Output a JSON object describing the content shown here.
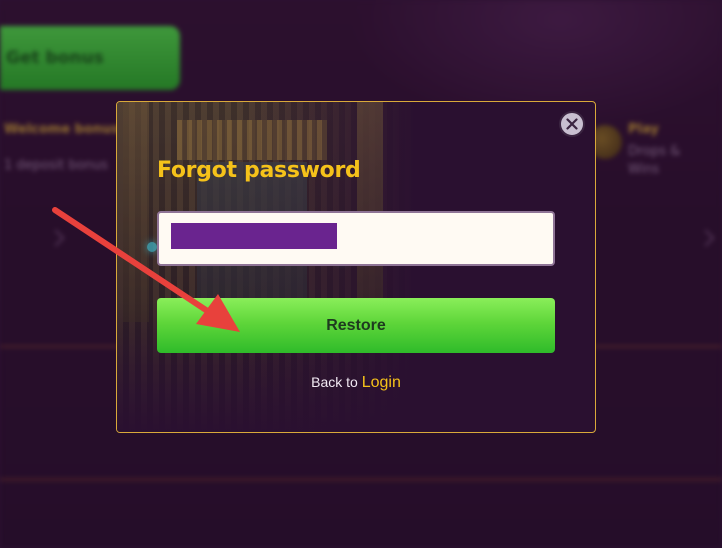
{
  "background": {
    "bonus_button_label": "Get bonus",
    "side_title": "Welcome bonus",
    "side_sub": "1 deposit bonus",
    "right_title": "Play",
    "right_sub_1": "Drops &",
    "right_sub_2": "Wins"
  },
  "modal": {
    "title": "Forgot password",
    "email_input": {
      "value": "",
      "placeholder": ""
    },
    "restore_label": "Restore",
    "back_text": "Back to",
    "login_link": "Login",
    "close_icon": "close-icon"
  },
  "colors": {
    "accent_gold": "#f5c21a",
    "button_green": "#5fd63a",
    "modal_border": "#d9a93a",
    "annotation_red": "#e8413c"
  }
}
